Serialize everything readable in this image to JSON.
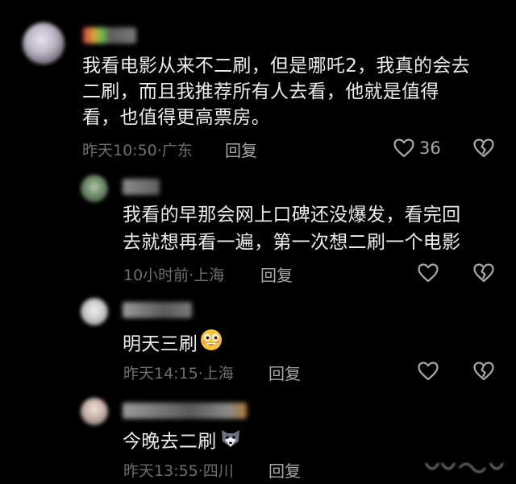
{
  "comments": [
    {
      "text_lines": [
        "我看电影从来不二刷，但是哪吒2，我真的会去",
        "二刷，而且我推荐所有人去看，他就是值得",
        "看，也值得更高票房。"
      ],
      "meta": "昨天10:50·广东",
      "reply_label": "回复",
      "like_count": "36"
    },
    {
      "text_lines": [
        "我看的早那会网上口碑还没爆发，看完回",
        "去就想再看一遍，第一次想二刷一个电影"
      ],
      "meta": "10小时前·上海",
      "reply_label": "回复"
    },
    {
      "text": "明天三刷",
      "meta": "昨天14:15·上海",
      "reply_label": "回复",
      "emoji": "grinning-emoji"
    },
    {
      "text": "今晚去二刷",
      "meta": "昨天13:55·四川",
      "reply_label": "回复",
      "emoji": "wolf-emoji"
    }
  ],
  "icons": {
    "like": "heart-outline-icon",
    "dislike": "broken-heart-icon"
  },
  "colors": {
    "background": "#000000",
    "text": "#ececec",
    "meta": "#6e6e6e",
    "action": "#a8a8a8"
  }
}
